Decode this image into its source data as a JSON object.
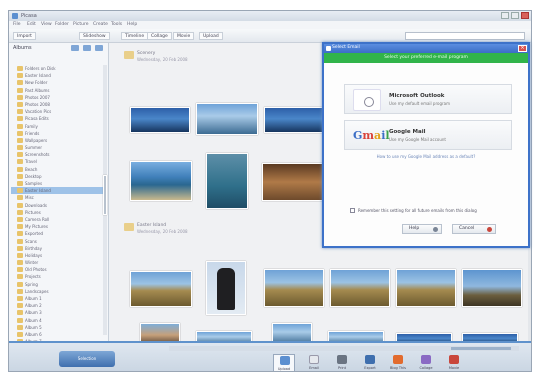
{
  "app": {
    "title": "Picasa"
  },
  "menu": [
    "File",
    "Edit",
    "View",
    "Folder",
    "Picture",
    "Create",
    "Tools",
    "Help"
  ],
  "toolbar": {
    "buttons": [
      "Import",
      "Slideshow",
      "Timeline",
      "Collage",
      "Movie",
      "Upload"
    ],
    "search_placeholder": ""
  },
  "sidebar": {
    "header": "Albums",
    "folders": [
      "Folders on Disk",
      "Easter Island",
      "New Folder",
      "Past Albums",
      "Photos 2007",
      "Photos 2008",
      "Vacation Pics",
      "Picasa Edits",
      "Family",
      "Friends",
      "Wallpapers",
      "Summer",
      "Screenshots",
      "Travel",
      "Beach",
      "Desktop",
      "Samples",
      "Easter Island",
      "Misc",
      "Downloads",
      "Pictures",
      "Camera Roll",
      "My Pictures",
      "Exported",
      "Scans",
      "Birthday",
      "Holidays",
      "Winter",
      "Old Photos",
      "Projects",
      "Spring",
      "Landscapes",
      "Album 1",
      "Album 2",
      "Album 3",
      "Album 4",
      "Album 5",
      "Album 6",
      "Album 7",
      "Album 8"
    ],
    "selected_index": 17
  },
  "groups": [
    {
      "title": "Scenery",
      "date": "Wednesday, 20 Feb 2008"
    },
    {
      "title": "Easter Island",
      "date": "Wednesday, 20 Feb 2008"
    }
  ],
  "dialog": {
    "title": "Select Email",
    "banner": "Select your preferred e-mail program",
    "options": [
      {
        "title": "Microsoft Outlook",
        "subtitle": "Use my default email program",
        "icon": "outlook-icon"
      },
      {
        "title": "Google Mail",
        "subtitle": "Use my Google Mail account",
        "icon": "gmail-icon",
        "logo_text": "Gmail"
      }
    ],
    "link": "How to use my Google Mail address as a default?",
    "checkbox_label": "Remember this setting for all future emails from this dialog",
    "ok_label": "Help",
    "cancel_label": "Cancel"
  },
  "bottom": {
    "logo_label": "Selection",
    "actions": [
      "Upload",
      "Email",
      "Print",
      "Export",
      "Blog This",
      "Collage",
      "Movie"
    ]
  }
}
